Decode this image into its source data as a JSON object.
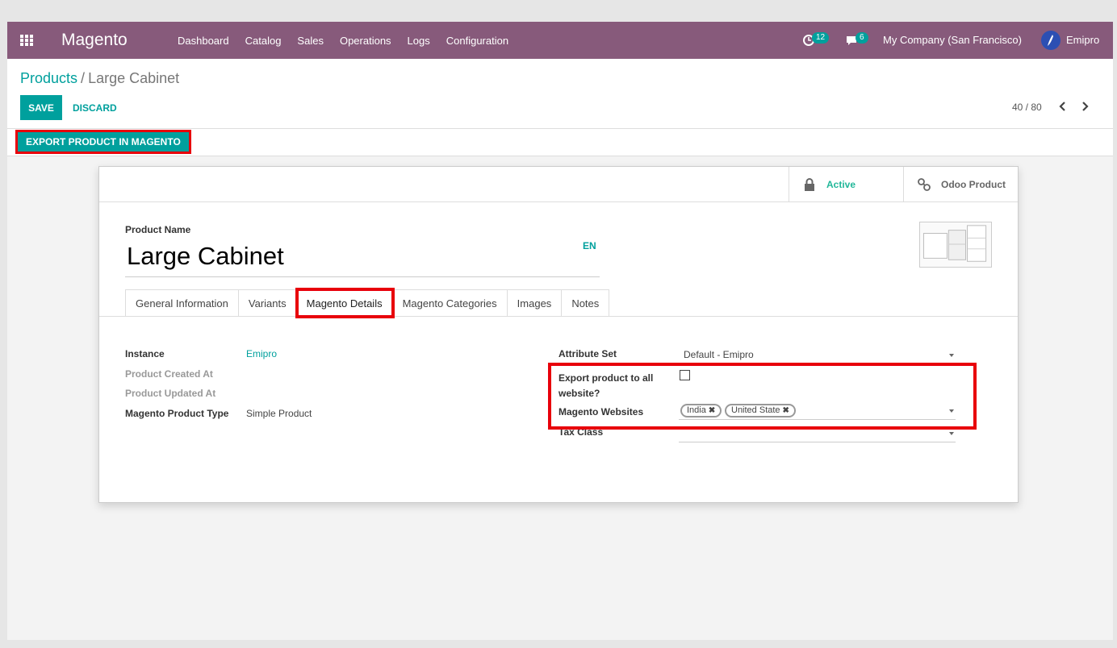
{
  "navbar": {
    "brand": "Magento",
    "menu": [
      "Dashboard",
      "Catalog",
      "Sales",
      "Operations",
      "Logs",
      "Configuration"
    ],
    "activity_count": "12",
    "messages_count": "6",
    "company": "My Company (San Francisco)",
    "user": "Emipro"
  },
  "breadcrumb": {
    "parent": "Products",
    "separator": "/",
    "current": "Large Cabinet"
  },
  "buttons": {
    "save": "SAVE",
    "discard": "DISCARD",
    "export": "EXPORT PRODUCT IN MAGENTO"
  },
  "pager": {
    "value": "40 / 80"
  },
  "smart_buttons": {
    "active": "Active",
    "odoo_product": "Odoo Product"
  },
  "product": {
    "name_label": "Product Name",
    "name": "Large Cabinet",
    "lang": "EN"
  },
  "tabs": [
    "General Information",
    "Variants",
    "Magento Details",
    "Magento Categories",
    "Images",
    "Notes"
  ],
  "active_tab": "Magento Details",
  "left_fields": {
    "instance_label": "Instance",
    "instance_value": "Emipro",
    "created_label": "Product Created At",
    "updated_label": "Product Updated At",
    "type_label": "Magento Product Type",
    "type_value": "Simple Product"
  },
  "right_fields": {
    "attribute_set_label": "Attribute Set",
    "attribute_set_value": "Default - Emipro",
    "export_all_label": "Export product to all website?",
    "export_all_checked": false,
    "websites_label": "Magento Websites",
    "websites": [
      "India",
      "United State"
    ],
    "tax_class_label": "Tax Class",
    "tax_class_value": ""
  },
  "colors": {
    "navbar": "#875a7b",
    "accent": "#00a09d",
    "highlight": "#e8000b",
    "active_green": "#21b799"
  }
}
